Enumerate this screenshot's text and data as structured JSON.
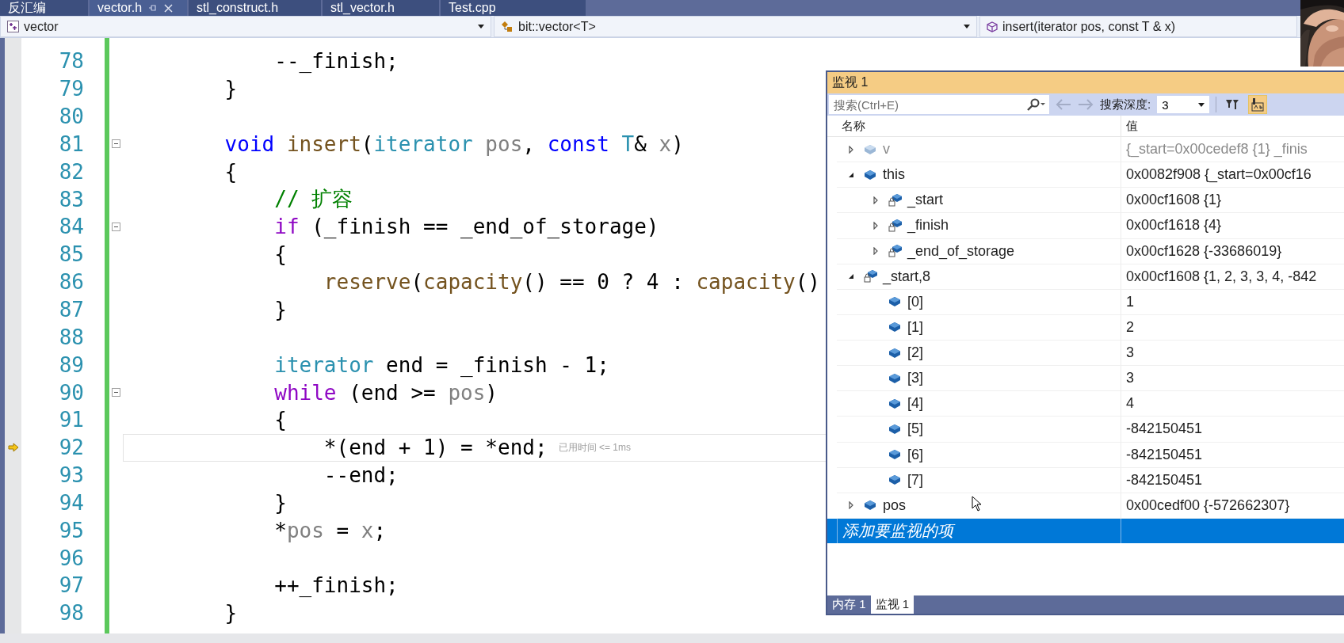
{
  "doc_tabs": [
    {
      "label": "反汇编",
      "selected": false
    },
    {
      "label": "vector.h",
      "selected": true
    },
    {
      "label": "stl_construct.h",
      "selected": false
    },
    {
      "label": "stl_vector.h",
      "selected": false
    },
    {
      "label": "Test.cpp",
      "selected": false
    }
  ],
  "nav_bar": {
    "scope": "vector",
    "type": "bit::vector<T>",
    "member": "insert(iterator pos, const T & x)"
  },
  "editor": {
    "lines": [
      {
        "number": "78",
        "current": false,
        "foldable": false,
        "tokens": [
          {
            "text": "        --_finish;",
            "kind": "plain"
          }
        ]
      },
      {
        "number": "79",
        "current": false,
        "foldable": false,
        "tokens": [
          {
            "text": "    }",
            "kind": "plain"
          }
        ]
      },
      {
        "number": "80",
        "current": false,
        "foldable": false
      },
      {
        "number": "81",
        "current": false,
        "foldable": true,
        "tokens": [
          {
            "text": "    void",
            "kind": "keyword"
          },
          {
            "text": " insert",
            "kind": "function"
          },
          {
            "text": "(",
            "kind": "plain"
          },
          {
            "text": "iterator",
            "kind": "type"
          },
          {
            "text": " pos",
            "kind": "parameter"
          },
          {
            "text": ", ",
            "kind": "plain"
          },
          {
            "text": "const",
            "kind": "keyword"
          },
          {
            "text": " T",
            "kind": "type"
          },
          {
            "text": "& ",
            "kind": "plain"
          },
          {
            "text": "x",
            "kind": "parameter"
          },
          {
            "text": ")",
            "kind": "plain"
          }
        ]
      },
      {
        "number": "82",
        "current": false,
        "foldable": false,
        "tokens": [
          {
            "text": "    {",
            "kind": "plain"
          }
        ]
      },
      {
        "number": "83",
        "current": false,
        "foldable": false,
        "tokens": [
          {
            "text": "        // 扩容",
            "kind": "comment"
          }
        ]
      },
      {
        "number": "84",
        "current": false,
        "foldable": true,
        "tokens": [
          {
            "text": "        if",
            "kind": "control"
          },
          {
            "text": " (_finish == _end_of_storage)",
            "kind": "plain"
          }
        ]
      },
      {
        "number": "85",
        "current": false,
        "foldable": false,
        "tokens": [
          {
            "text": "        {",
            "kind": "plain"
          }
        ]
      },
      {
        "number": "86",
        "current": false,
        "foldable": false,
        "tokens": [
          {
            "text": "            reserve",
            "kind": "function"
          },
          {
            "text": "(",
            "kind": "plain"
          },
          {
            "text": "capacity",
            "kind": "function"
          },
          {
            "text": "() == 0 ? 4 : ",
            "kind": "plain"
          },
          {
            "text": "capacity",
            "kind": "function"
          },
          {
            "text": "()",
            "kind": "plain"
          }
        ]
      },
      {
        "number": "87",
        "current": false,
        "foldable": false,
        "tokens": [
          {
            "text": "        }",
            "kind": "plain"
          }
        ]
      },
      {
        "number": "88",
        "current": false,
        "foldable": false
      },
      {
        "number": "89",
        "current": false,
        "foldable": false,
        "tokens": [
          {
            "text": "        iterator",
            "kind": "type"
          },
          {
            "text": " end = _finish - 1;",
            "kind": "plain"
          }
        ]
      },
      {
        "number": "90",
        "current": false,
        "foldable": true,
        "tokens": [
          {
            "text": "        while",
            "kind": "control"
          },
          {
            "text": " (end >= ",
            "kind": "plain"
          },
          {
            "text": "pos",
            "kind": "parameter"
          },
          {
            "text": ")",
            "kind": "plain"
          }
        ]
      },
      {
        "number": "91",
        "current": false,
        "foldable": false,
        "tokens": [
          {
            "text": "        {",
            "kind": "plain"
          }
        ]
      },
      {
        "number": "92",
        "current": true,
        "foldable": false,
        "tokens": [
          {
            "text": "            *(end + 1) = *end;",
            "kind": "plain"
          }
        ],
        "hint": "已用时间 <= 1ms"
      },
      {
        "number": "93",
        "current": false,
        "foldable": false,
        "tokens": [
          {
            "text": "            --end;",
            "kind": "plain"
          }
        ]
      },
      {
        "number": "94",
        "current": false,
        "foldable": false,
        "tokens": [
          {
            "text": "        }",
            "kind": "plain"
          }
        ]
      },
      {
        "number": "95",
        "current": false,
        "foldable": false,
        "tokens": [
          {
            "text": "        *",
            "kind": "plain"
          },
          {
            "text": "pos",
            "kind": "parameter"
          },
          {
            "text": " = ",
            "kind": "plain"
          },
          {
            "text": "x",
            "kind": "parameter"
          },
          {
            "text": ";",
            "kind": "plain"
          }
        ]
      },
      {
        "number": "96",
        "current": false,
        "foldable": false
      },
      {
        "number": "97",
        "current": false,
        "foldable": false,
        "tokens": [
          {
            "text": "        ++_finish;",
            "kind": "plain"
          }
        ]
      },
      {
        "number": "98",
        "current": false,
        "foldable": false,
        "tokens": [
          {
            "text": "    }",
            "kind": "plain"
          }
        ]
      }
    ]
  },
  "watch": {
    "title": "监视 1",
    "toolbar": {
      "search_placeholder": "搜索(Ctrl+E)",
      "depth_label": "搜索深度:",
      "depth": "3",
      "hex_on": true
    },
    "columns": [
      "名称",
      "值"
    ],
    "rows": [
      {
        "name": "v",
        "value": "{_start=0x00cedef8 {1} _finis",
        "kind": "object",
        "expanded": false,
        "disabled": true
      },
      {
        "name": "this",
        "value": "0x0082f908 {_start=0x00cf16",
        "kind": "object",
        "expanded": true,
        "disabled": false,
        "children": [
          {
            "name": "_start",
            "value": "0x00cf1608 {1}",
            "kind": "member",
            "expanded": false
          },
          {
            "name": "_finish",
            "value": "0x00cf1618 {4}",
            "kind": "member",
            "expanded": false
          },
          {
            "name": "_end_of_storage",
            "value": "0x00cf1628 {-33686019}",
            "kind": "member",
            "expanded": false
          }
        ]
      },
      {
        "name": "_start,8",
        "value": "0x00cf1608 {1, 2, 3, 3, 4, -842",
        "kind": "member",
        "expanded": true,
        "disabled": false,
        "children": [
          {
            "name": "[0]",
            "value": "1",
            "kind": "object"
          },
          {
            "name": "[1]",
            "value": "2",
            "kind": "object"
          },
          {
            "name": "[2]",
            "value": "3",
            "kind": "object"
          },
          {
            "name": "[3]",
            "value": "3",
            "kind": "object"
          },
          {
            "name": "[4]",
            "value": "4",
            "kind": "object"
          },
          {
            "name": "[5]",
            "value": "-842150451",
            "kind": "object"
          },
          {
            "name": "[6]",
            "value": "-842150451",
            "kind": "object"
          },
          {
            "name": "[7]",
            "value": "-842150451",
            "kind": "object"
          }
        ]
      },
      {
        "name": "pos",
        "value": "0x00cedf00 {-572662307}",
        "kind": "object",
        "expanded": false,
        "disabled": false
      }
    ],
    "add_row": "添加要监视的项",
    "bottom_tabs": [
      {
        "label": "内存 1",
        "selected": false
      },
      {
        "label": "监视 1",
        "selected": true
      }
    ]
  }
}
